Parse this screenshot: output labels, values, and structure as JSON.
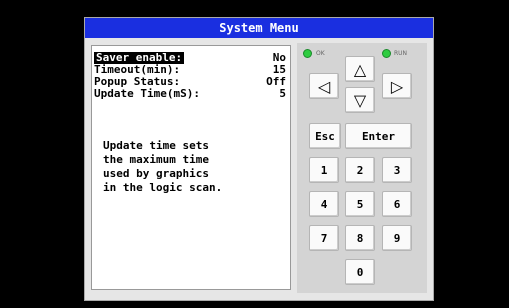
{
  "window": {
    "title": "System Menu"
  },
  "settings": [
    {
      "label": "Saver enable:",
      "value": "No"
    },
    {
      "label": "Timeout(min):",
      "value": "15"
    },
    {
      "label": "Popup Status:",
      "value": "Off"
    },
    {
      "label": "Update Time(mS):",
      "value": "5"
    }
  ],
  "help_text": "Update time sets\nthe maximum time\nused by graphics\nin the logic scan.",
  "indicators": {
    "ok_label": "OK",
    "run_label": "RUN",
    "led_color": "#2ecc40"
  },
  "keys": {
    "left": "◁",
    "up": "△",
    "right": "▷",
    "down": "▽",
    "esc": "Esc",
    "enter": "Enter",
    "d1": "1",
    "d2": "2",
    "d3": "3",
    "d4": "4",
    "d5": "5",
    "d6": "6",
    "d7": "7",
    "d8": "8",
    "d9": "9",
    "d0": "0"
  }
}
